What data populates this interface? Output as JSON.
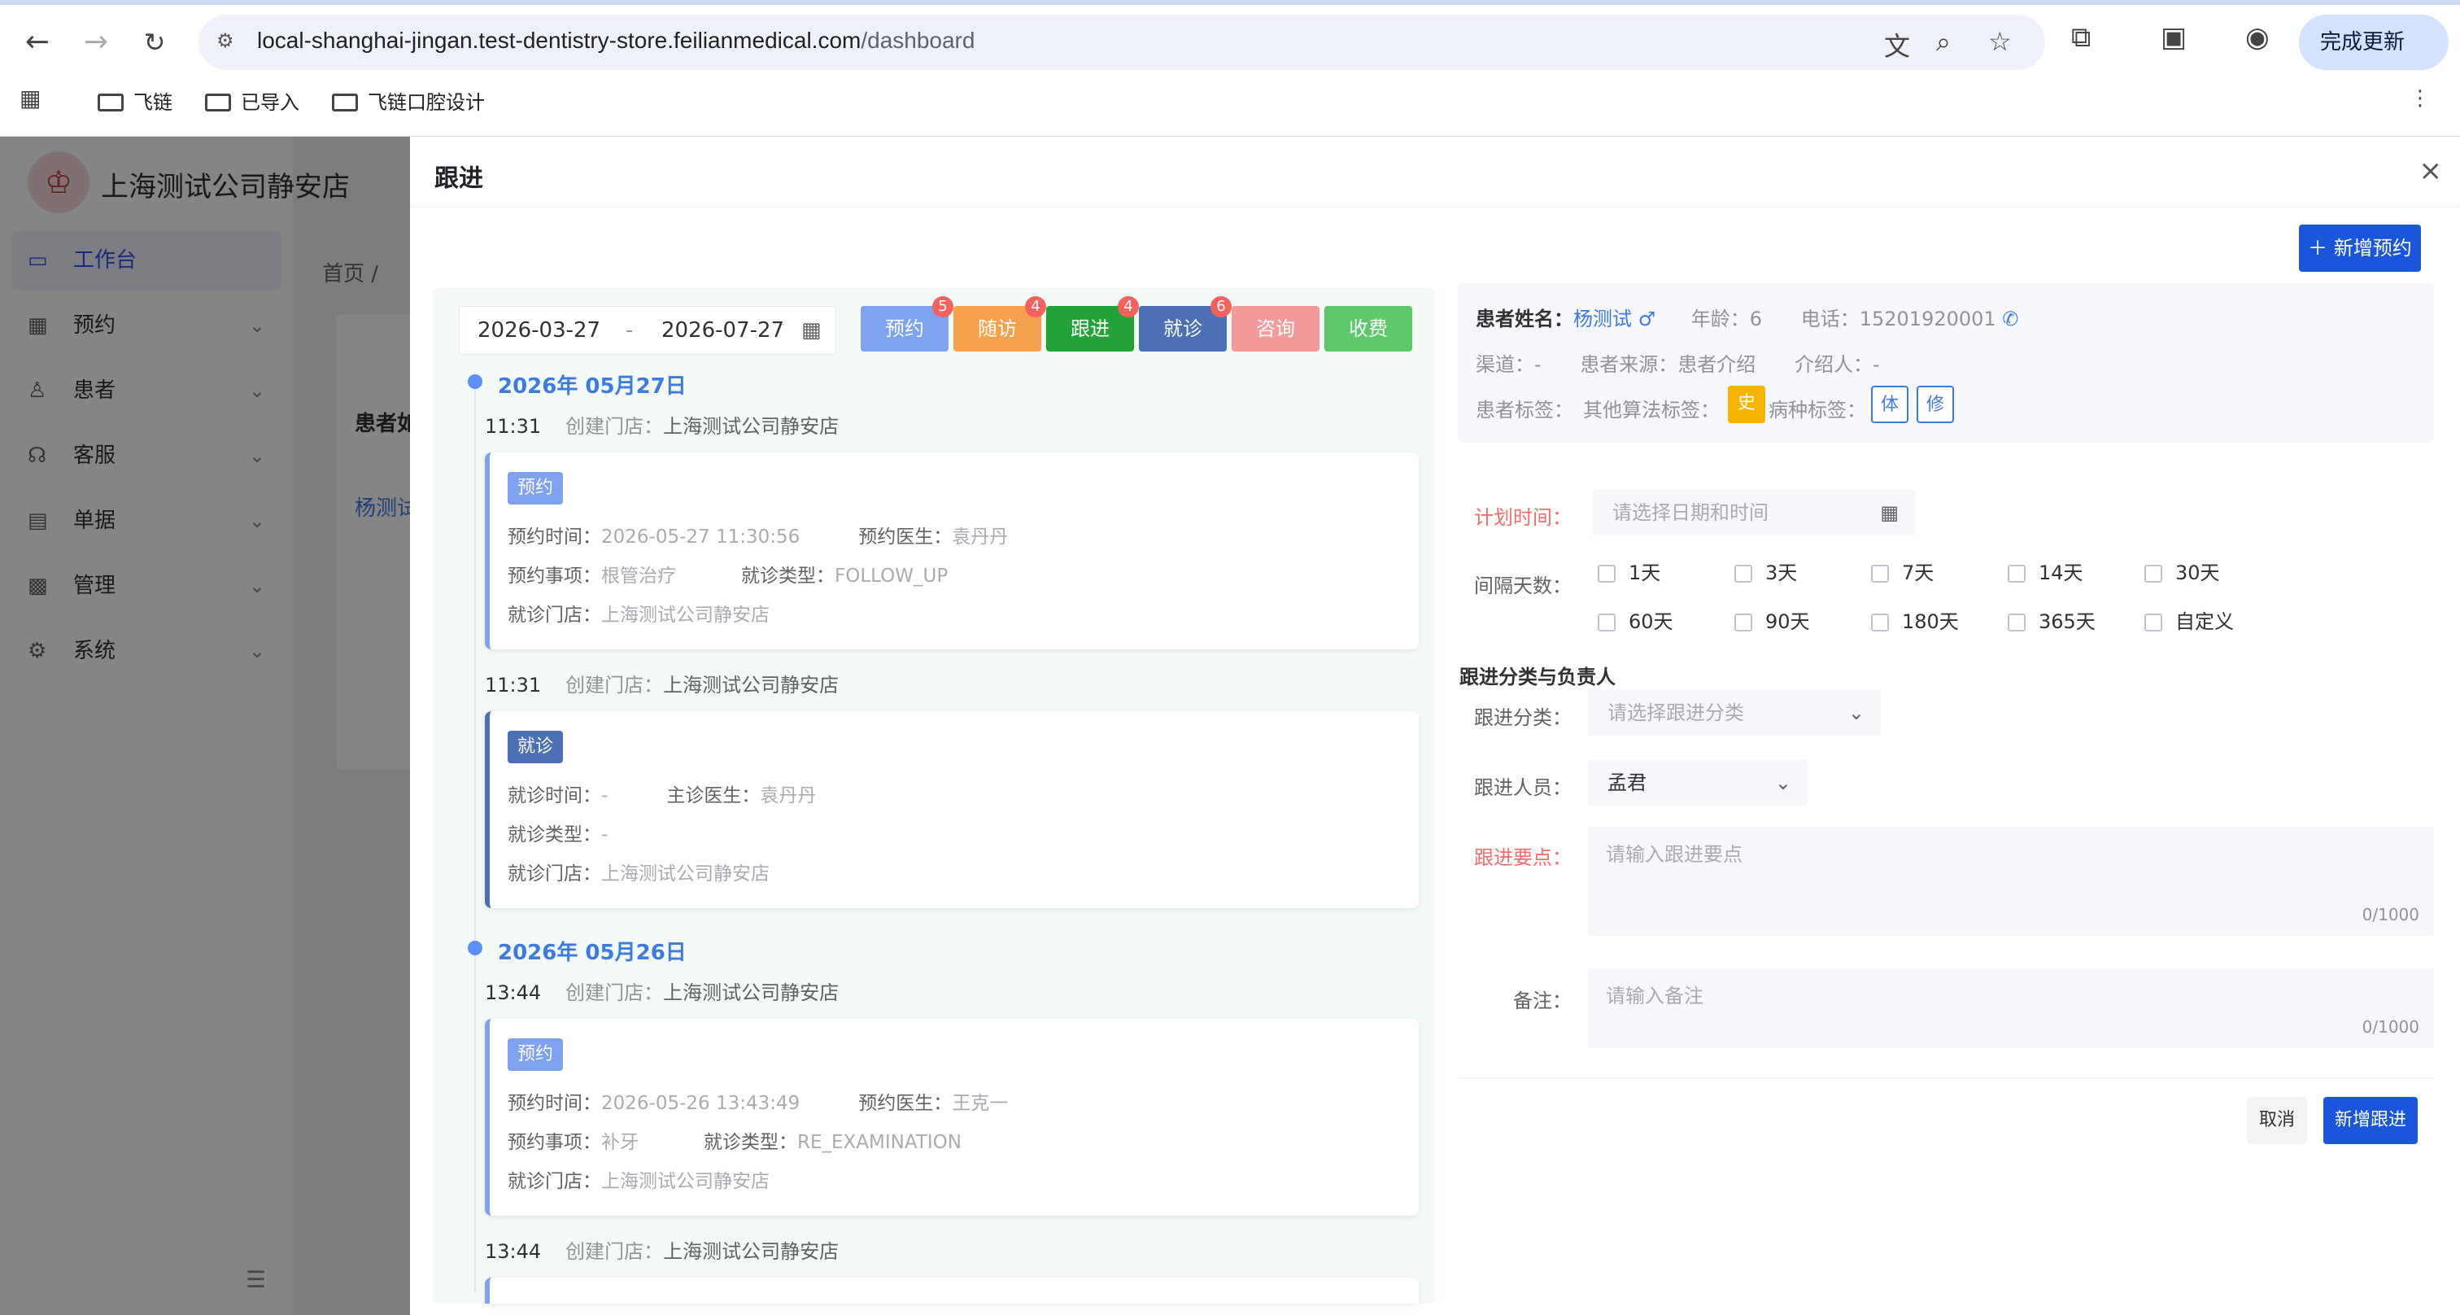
{
  "browser": {
    "url_host": "local-shanghai-jingan.test-dentistry-store.feilianmedical.com",
    "url_path": "/dashboard",
    "update_button": "完成更新",
    "bookmarks": [
      "飞链",
      "已导入",
      "飞链口腔设计"
    ]
  },
  "sidebar": {
    "store_name": "上海测试公司静安店",
    "items": [
      {
        "label": "工作台",
        "icon": "monitor-icon"
      },
      {
        "label": "预约",
        "icon": "calendar-icon"
      },
      {
        "label": "患者",
        "icon": "user-icon"
      },
      {
        "label": "客服",
        "icon": "headset-icon"
      },
      {
        "label": "单据",
        "icon": "document-icon"
      },
      {
        "label": "管理",
        "icon": "grid-icon"
      },
      {
        "label": "系统",
        "icon": "gear-icon"
      }
    ]
  },
  "background": {
    "breadcrumb": "首页 /",
    "patient_label": "患者如",
    "patient_link": "杨测试"
  },
  "drawer": {
    "title": "跟进",
    "close": "×",
    "new_appointment": "新增预约",
    "date_start": "2026-03-27",
    "date_sep": "-",
    "date_end": "2026-07-27",
    "filters": [
      {
        "label": "预约",
        "badge": "5",
        "color": "#7ea1f0"
      },
      {
        "label": "随访",
        "badge": "4",
        "color": "#f5a04a"
      },
      {
        "label": "跟进",
        "badge": "4",
        "color": "#21a338"
      },
      {
        "label": "就诊",
        "badge": "6",
        "color": "#4d6fb5"
      },
      {
        "label": "咨询",
        "badge": "",
        "color": "#f39b9b"
      },
      {
        "label": "收费",
        "badge": "",
        "color": "#5cc86a"
      }
    ],
    "timeline": {
      "day1": {
        "date": "2026年 05月27日",
        "row1": {
          "time": "11:31",
          "store_label": "创建门店：",
          "store": "上海测试公司静安店"
        },
        "card1": {
          "tag": "预约",
          "time_label": "预约时间：",
          "time": "2026-05-27 11:30:56",
          "doctor_label": "预约医生：",
          "doctor": "袁丹丹",
          "item_label": "预约事项：",
          "item": "根管治疗",
          "type_label": "就诊类型：",
          "type": "FOLLOW_UP",
          "store_label": "就诊门店：",
          "store": "上海测试公司静安店"
        },
        "row2": {
          "time": "11:31",
          "store_label": "创建门店：",
          "store": "上海测试公司静安店"
        },
        "card2": {
          "tag": "就诊",
          "time_label": "就诊时间：",
          "time": "-",
          "doctor_label": "主诊医生：",
          "doctor": "袁丹丹",
          "type_label": "就诊类型：",
          "type": "-",
          "store_label": "就诊门店：",
          "store": "上海测试公司静安店"
        }
      },
      "day2": {
        "date": "2026年 05月26日",
        "row1": {
          "time": "13:44",
          "store_label": "创建门店：",
          "store": "上海测试公司静安店"
        },
        "card1": {
          "tag": "预约",
          "time_label": "预约时间：",
          "time": "2026-05-26 13:43:49",
          "doctor_label": "预约医生：",
          "doctor": "王克一",
          "item_label": "预约事项：",
          "item": "补牙",
          "type_label": "就诊类型：",
          "type": "RE_EXAMINATION",
          "store_label": "就诊门店：",
          "store": "上海测试公司静安店"
        },
        "row2": {
          "time": "13:44",
          "store_label": "创建门店：",
          "store": "上海测试公司静安店"
        }
      }
    },
    "patient": {
      "name_label": "患者姓名：",
      "name": "杨测试",
      "gender_icon": "male-icon",
      "age_label": "年龄：",
      "age": "6",
      "phone_label": "电话：",
      "phone": "15201920001",
      "channel_label": "渠道：",
      "channel": "-",
      "source_label": "患者来源：",
      "source": "患者介绍",
      "referrer_label": "介绍人：",
      "referrer": "-",
      "tags_label": "患者标签：",
      "algo_label": "其他算法标签：",
      "algo_tag": "史",
      "disease_label": "病种标签：",
      "disease_tags": [
        "体",
        "修"
      ]
    },
    "form": {
      "plan_time_label": "计划时间：",
      "plan_time_placeholder": "请选择日期和时间",
      "interval_label": "间隔天数：",
      "intervals": [
        "1天",
        "3天",
        "7天",
        "14天",
        "30天",
        "60天",
        "90天",
        "180天",
        "365天",
        "自定义"
      ],
      "section_title": "跟进分类与负责人",
      "category_label": "跟进分类：",
      "category_placeholder": "请选择跟进分类",
      "person_label": "跟进人员：",
      "person_value": "孟君",
      "points_label": "跟进要点：",
      "points_placeholder": "请输入跟进要点",
      "points_count": "0/1000",
      "remark_label": "备注：",
      "remark_placeholder": "请输入备注",
      "remark_count": "0/1000",
      "cancel": "取消",
      "submit": "新增跟进"
    }
  }
}
